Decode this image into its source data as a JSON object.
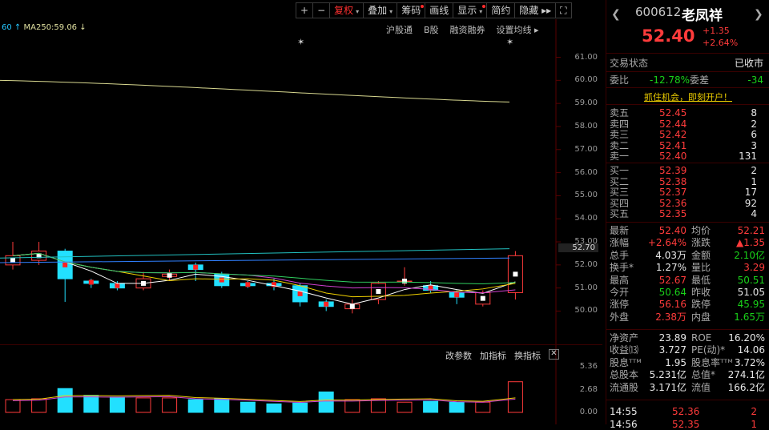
{
  "toolbar": [
    {
      "label": "+",
      "active": false,
      "dot": false,
      "arrow": false
    },
    {
      "label": "−",
      "active": false,
      "dot": false,
      "arrow": false
    },
    {
      "label": "复权",
      "active": true,
      "dot": false,
      "arrow": true
    },
    {
      "label": "叠加",
      "active": false,
      "dot": false,
      "arrow": true
    },
    {
      "label": "筹码",
      "active": false,
      "dot": true,
      "arrow": false
    },
    {
      "label": "画线",
      "active": false,
      "dot": false,
      "arrow": false
    },
    {
      "label": "显示",
      "active": false,
      "dot": true,
      "arrow": true
    },
    {
      "label": "简约",
      "active": false,
      "dot": false,
      "arrow": false
    },
    {
      "label": "隐藏 ▸▸",
      "active": false,
      "dot": false,
      "arrow": false
    },
    {
      "label": "⛶",
      "active": false,
      "dot": false,
      "arrow": false
    }
  ],
  "ma_bar": {
    "left": "60",
    "ma250": "MA250:59.06"
  },
  "chart_links": [
    "沪股通",
    "B股",
    "融资融券",
    "设置均线 ▸"
  ],
  "subchart_bar": [
    "改参数",
    "加指标",
    "换指标",
    "✕"
  ],
  "chart_data": {
    "type": "candlestick",
    "y_ticks": [
      "61.00",
      "60.00",
      "59.00",
      "58.00",
      "57.00",
      "56.00",
      "55.00",
      "54.00",
      "53.00",
      "52.00",
      "51.00",
      "50.00"
    ],
    "ylim": [
      49.6,
      61.4
    ],
    "last_price_tag": "52.70",
    "ma250": [
      60.0,
      59.06
    ],
    "candles": [
      {
        "o": 52.0,
        "c": 52.4,
        "h": 53.0,
        "l": 51.8
      },
      {
        "o": 52.2,
        "c": 52.6,
        "h": 53.0,
        "l": 52.0
      },
      {
        "o": 52.6,
        "c": 51.4,
        "h": 52.7,
        "l": 50.4
      },
      {
        "o": 51.3,
        "c": 51.2,
        "h": 51.4,
        "l": 51.0
      },
      {
        "o": 51.2,
        "c": 51.0,
        "h": 51.3,
        "l": 50.9
      },
      {
        "o": 51.0,
        "c": 51.4,
        "h": 51.7,
        "l": 50.9
      },
      {
        "o": 51.5,
        "c": 51.6,
        "h": 51.8,
        "l": 51.3
      },
      {
        "o": 52.0,
        "c": 51.8,
        "h": 52.1,
        "l": 51.3
      },
      {
        "o": 51.6,
        "c": 51.1,
        "h": 51.7,
        "l": 51.0
      },
      {
        "o": 51.2,
        "c": 51.1,
        "h": 51.3,
        "l": 51.0
      },
      {
        "o": 51.2,
        "c": 51.1,
        "h": 51.4,
        "l": 50.9
      },
      {
        "o": 51.1,
        "c": 50.4,
        "h": 51.2,
        "l": 50.2
      },
      {
        "o": 50.4,
        "c": 50.2,
        "h": 50.5,
        "l": 50.0
      },
      {
        "o": 50.1,
        "c": 50.3,
        "h": 50.5,
        "l": 49.9
      },
      {
        "o": 50.5,
        "c": 51.2,
        "h": 51.3,
        "l": 50.3
      },
      {
        "o": 51.3,
        "c": 51.3,
        "h": 51.9,
        "l": 51.1
      },
      {
        "o": 51.1,
        "c": 50.9,
        "h": 51.3,
        "l": 50.8
      },
      {
        "o": 50.8,
        "c": 50.6,
        "h": 50.9,
        "l": 50.3
      },
      {
        "o": 50.3,
        "c": 50.8,
        "h": 50.9,
        "l": 50.2
      },
      {
        "o": 50.8,
        "c": 52.4,
        "h": 52.6,
        "l": 50.5
      }
    ],
    "sub_ticks": [
      "5.36",
      "2.68",
      "0.00"
    ],
    "volumes": [
      1.5,
      1.6,
      2.8,
      2.0,
      1.8,
      1.7,
      1.7,
      1.5,
      1.6,
      1.2,
      1.0,
      1.1,
      2.4,
      1.5,
      1.6,
      1.2,
      1.3,
      1.2,
      1.2,
      3.6
    ]
  },
  "panel": {
    "code": "600612",
    "name": "老凤祥",
    "price": "52.40",
    "change": "+1.35",
    "change_pct": "+2.64%",
    "status_label": "交易状态",
    "status_value": "已收市",
    "weibi_label": "委比",
    "weibi_value": "-12.78%",
    "weicha_label": "委差",
    "weicha_value": "-34",
    "promo": "抓住机会，即刻开户！",
    "asks": [
      {
        "label": "卖五",
        "price": "52.45",
        "vol": "8"
      },
      {
        "label": "卖四",
        "price": "52.44",
        "vol": "2"
      },
      {
        "label": "卖三",
        "price": "52.42",
        "vol": "6"
      },
      {
        "label": "卖二",
        "price": "52.41",
        "vol": "3"
      },
      {
        "label": "卖一",
        "price": "52.40",
        "vol": "131"
      }
    ],
    "bids": [
      {
        "label": "买一",
        "price": "52.39",
        "vol": "2"
      },
      {
        "label": "买二",
        "price": "52.38",
        "vol": "1"
      },
      {
        "label": "买三",
        "price": "52.37",
        "vol": "17"
      },
      {
        "label": "买四",
        "price": "52.36",
        "vol": "92"
      },
      {
        "label": "买五",
        "price": "52.35",
        "vol": "4"
      }
    ],
    "stats": [
      {
        "l1": "最新",
        "v1": "52.40",
        "c1": "red",
        "l2": "均价",
        "v2": "52.21",
        "c2": "red"
      },
      {
        "l1": "涨幅",
        "v1": "+2.64%",
        "c1": "red",
        "l2": "涨跌",
        "v2": "▲1.35",
        "c2": "red"
      },
      {
        "l1": "总手",
        "v1": "4.03万",
        "c1": "white",
        "l2": "金额",
        "v2": "2.10亿",
        "c2": "green"
      },
      {
        "l1": "换手*",
        "v1": "1.27%",
        "c1": "white",
        "l2": "量比",
        "v2": "3.29",
        "c2": "red"
      },
      {
        "l1": "最高",
        "v1": "52.67",
        "c1": "red",
        "l2": "最低",
        "v2": "50.51",
        "c2": "green"
      },
      {
        "l1": "今开",
        "v1": "50.64",
        "c1": "green",
        "l2": "昨收",
        "v2": "51.05",
        "c2": "white"
      },
      {
        "l1": "涨停",
        "v1": "56.16",
        "c1": "red",
        "l2": "跌停",
        "v2": "45.95",
        "c2": "green"
      },
      {
        "l1": "外盘",
        "v1": "2.38万",
        "c1": "red",
        "l2": "内盘",
        "v2": "1.65万",
        "c2": "green"
      }
    ],
    "fund": [
      {
        "l1": "净资产",
        "v1": "23.89",
        "l2": "ROE",
        "v2": "16.20%"
      },
      {
        "l1": "收益⒀",
        "v1": "3.727",
        "l2": "PE(动)*",
        "v2": "14.06"
      },
      {
        "l1": "股息ᵀᵀᴹ",
        "v1": "1.95",
        "l2": "股息率ᵀᵀᴹ",
        "v2": "3.72%"
      },
      {
        "l1": "总股本",
        "v1": "5.231亿",
        "l2": "总值*",
        "v2": "274.1亿"
      },
      {
        "l1": "流通股",
        "v1": "3.171亿",
        "l2": "流值",
        "v2": "166.2亿"
      }
    ],
    "ticks": [
      {
        "time": "14:55",
        "price": "52.36",
        "vol": "2"
      },
      {
        "time": "14:56",
        "price": "52.35",
        "vol": "1"
      }
    ]
  }
}
